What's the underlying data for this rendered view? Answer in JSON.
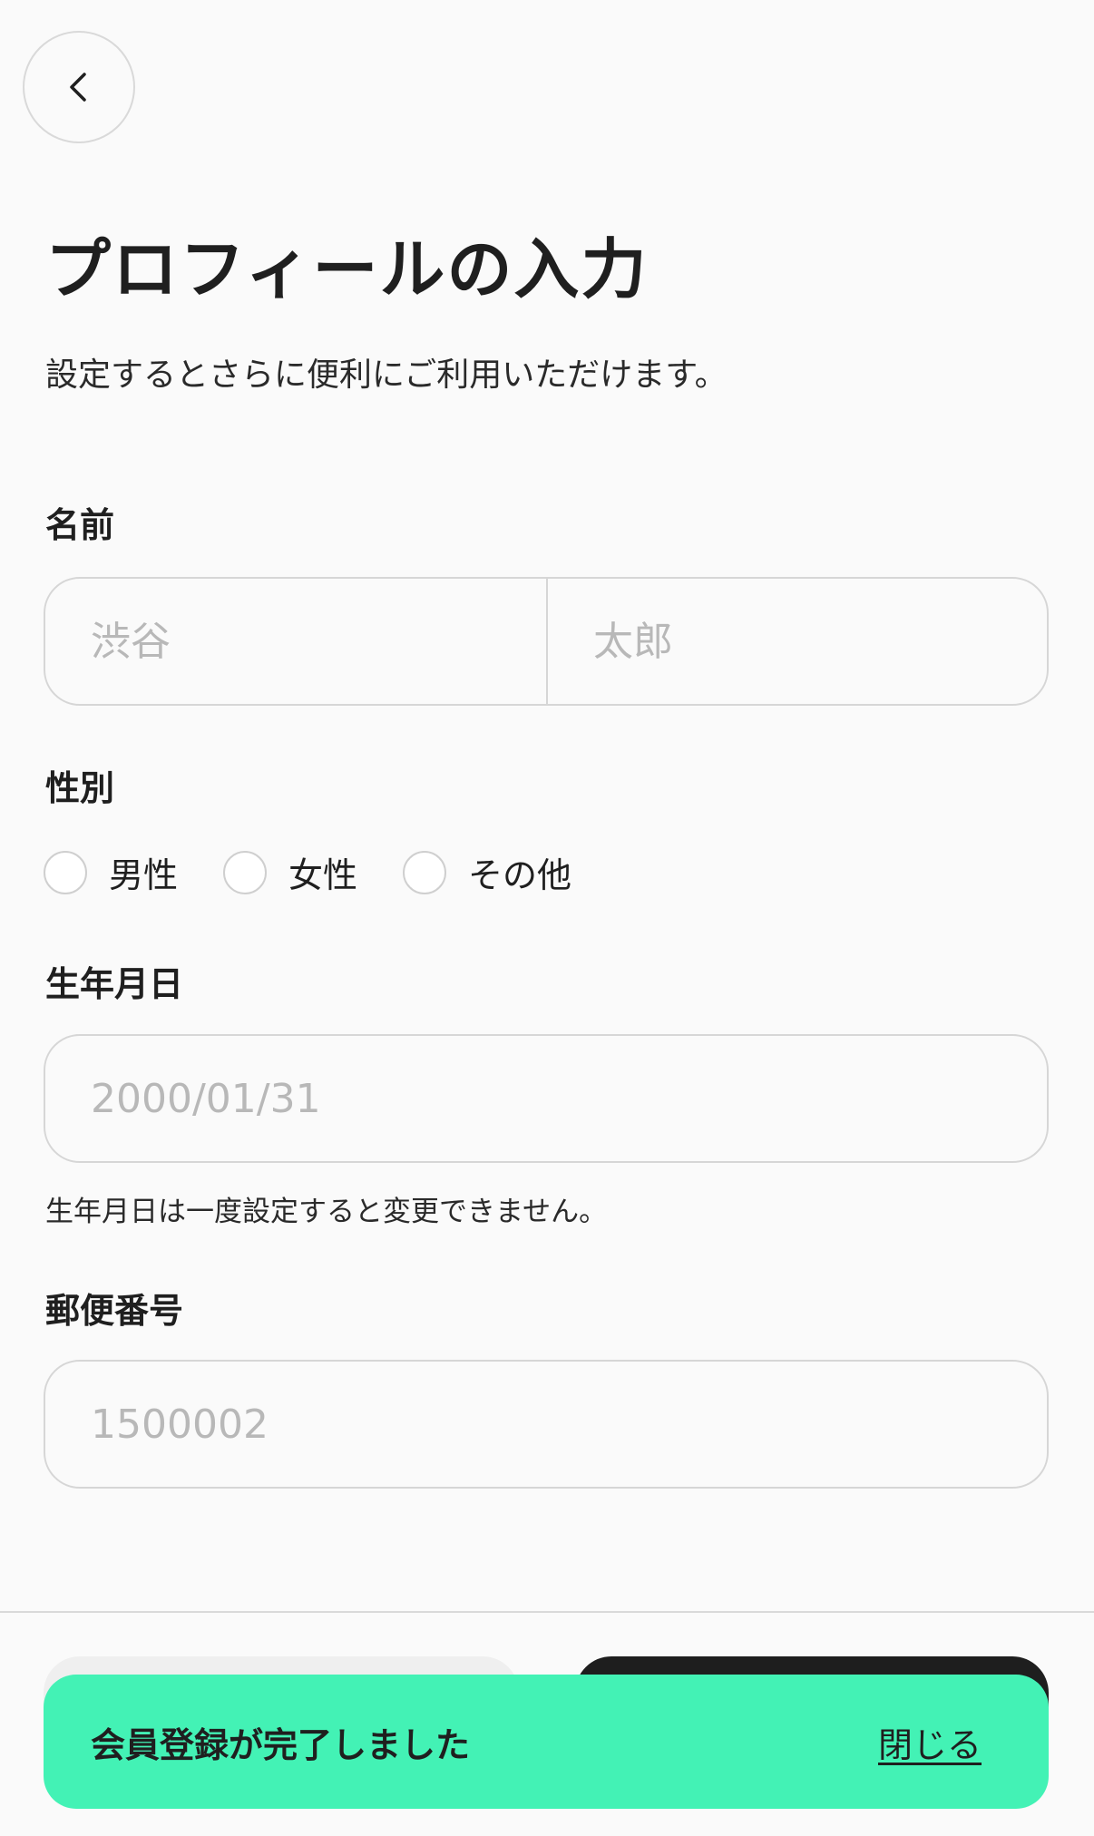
{
  "header": {
    "back_icon": "chevron-left-icon"
  },
  "page": {
    "title": "プロフィールの入力",
    "subtitle": "設定するとさらに便利にご利用いただけます。"
  },
  "name": {
    "label": "名前",
    "last_placeholder": "渋谷",
    "first_placeholder": "太郎"
  },
  "gender": {
    "label": "性別",
    "options": [
      "男性",
      "女性",
      "その他"
    ]
  },
  "birthday": {
    "label": "生年月日",
    "placeholder": "2000/01/31",
    "note": "生年月日は一度設定すると変更できません。"
  },
  "postal": {
    "label": "郵便番号",
    "placeholder": "1500002"
  },
  "toast": {
    "message": "会員登録が完了しました",
    "close_label": "閉じる",
    "color": "#43f2b5"
  }
}
